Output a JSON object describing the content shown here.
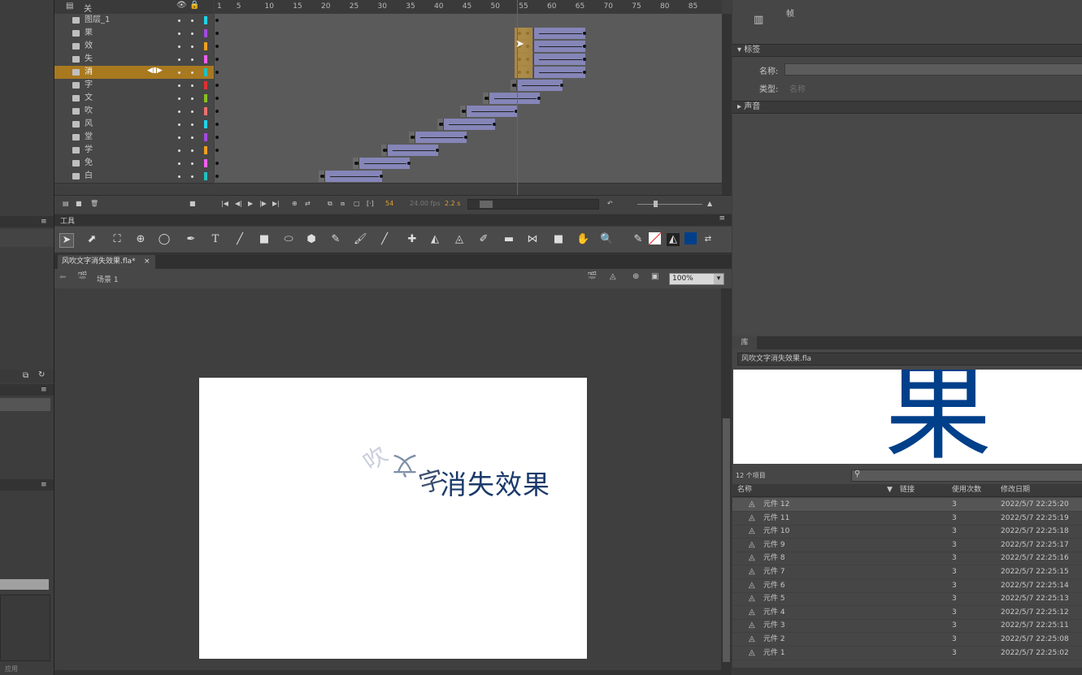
{
  "timeline": {
    "header_layer": "关",
    "ruler_labels": [
      "1",
      "5",
      "10",
      "15",
      "20",
      "25",
      "30",
      "35",
      "40",
      "45",
      "50",
      "55",
      "60",
      "65",
      "70",
      "75",
      "80",
      "85"
    ],
    "layers": [
      {
        "name": "图层_1",
        "color": "#22d3e8"
      },
      {
        "name": "果",
        "color": "#a34ae0"
      },
      {
        "name": "效",
        "color": "#f0a020"
      },
      {
        "name": "失",
        "color": "#f060f0"
      },
      {
        "name": "消",
        "color": "#22c0c0",
        "selected": true
      },
      {
        "name": "字",
        "color": "#e03030"
      },
      {
        "name": "文",
        "color": "#88c020"
      },
      {
        "name": "吹",
        "color": "#f07070"
      },
      {
        "name": "风",
        "color": "#22d3e8"
      },
      {
        "name": "堂",
        "color": "#a34ae0"
      },
      {
        "name": "学",
        "color": "#f0a020"
      },
      {
        "name": "免",
        "color": "#f060f0"
      },
      {
        "name": "白",
        "color": "#22c0c0"
      }
    ],
    "frame_rate": "24.00 fps",
    "current_frame": "54",
    "elapsed_time": "2.2 s"
  },
  "tools_header": "工具",
  "document": {
    "tab_label": "风吹文字消失效果.fla*",
    "scene_label": "场景 1",
    "zoom": "100%",
    "stage_text_main": "消失效果",
    "stage_text_scatter1": "吹",
    "stage_text_scatter2": "文",
    "stage_text_scatter3": "字"
  },
  "properties": {
    "frame_label": "帧",
    "label_section": "标签",
    "name_label": "名称:",
    "type_label": "类型:",
    "type_value": "名称",
    "sound_section": "声音"
  },
  "library": {
    "tab": "库",
    "file_dropdown": "风吹文字消失效果.fla",
    "preview_char": "果",
    "item_count": "12 个项目",
    "columns": {
      "name": "名称",
      "linkage": "链接",
      "use_count": "使用次数",
      "date": "修改日期"
    },
    "items": [
      {
        "name": "元件 12",
        "uses": "3",
        "date": "2022/5/7 22:25:20"
      },
      {
        "name": "元件 11",
        "uses": "3",
        "date": "2022/5/7 22:25:19"
      },
      {
        "name": "元件 10",
        "uses": "3",
        "date": "2022/5/7 22:25:18"
      },
      {
        "name": "元件 9",
        "uses": "3",
        "date": "2022/5/7 22:25:17"
      },
      {
        "name": "元件 8",
        "uses": "3",
        "date": "2022/5/7 22:25:16"
      },
      {
        "name": "元件 7",
        "uses": "3",
        "date": "2022/5/7 22:25:15"
      },
      {
        "name": "元件 6",
        "uses": "3",
        "date": "2022/5/7 22:25:14"
      },
      {
        "name": "元件 5",
        "uses": "3",
        "date": "2022/5/7 22:25:13"
      },
      {
        "name": "元件 4",
        "uses": "3",
        "date": "2022/5/7 22:25:12"
      },
      {
        "name": "元件 3",
        "uses": "3",
        "date": "2022/5/7 22:25:11"
      },
      {
        "name": "元件 2",
        "uses": "3",
        "date": "2022/5/7 22:25:08"
      },
      {
        "name": "元件 1",
        "uses": "3",
        "date": "2022/5/7 22:25:02"
      }
    ]
  },
  "left": {
    "apply_label": "应用"
  },
  "colors": {
    "selected_layer": "#a8791f",
    "tween": "#8585b8",
    "fill_swatch": "#003f8a",
    "stage_text": "#1b3a6b"
  }
}
